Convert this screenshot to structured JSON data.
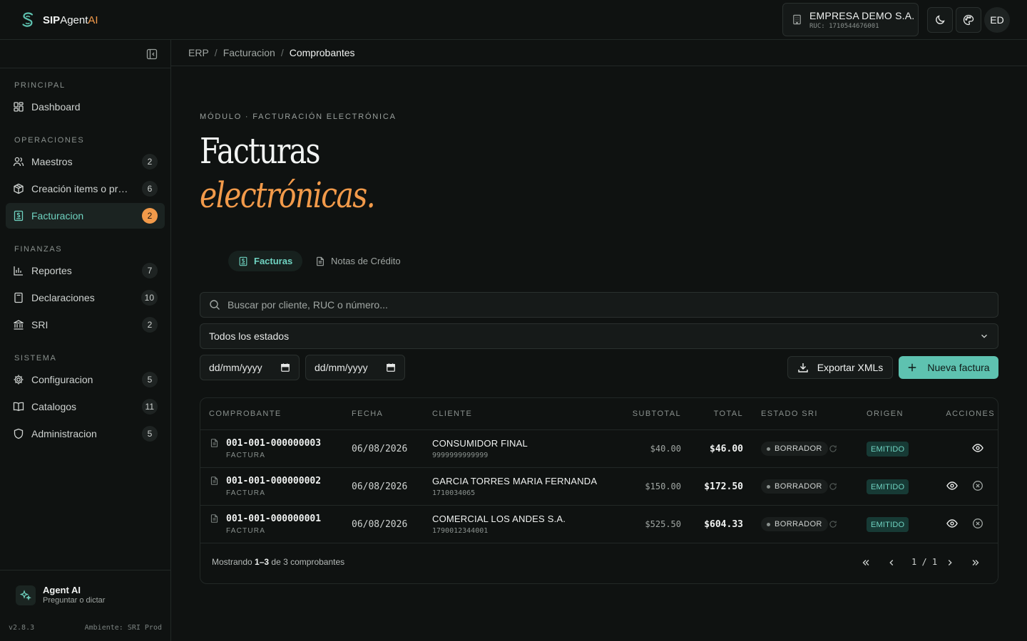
{
  "brand": {
    "sip": "SIP",
    "agent": "Agent",
    "ai": "AI"
  },
  "company": {
    "name": "EMPRESA DEMO S.A.",
    "ruc": "RUC: 1710544676001"
  },
  "user": {
    "initials": "ED"
  },
  "sidebar": {
    "sections": [
      {
        "title": "PRINCIPAL"
      },
      {
        "title": "OPERACIONES"
      },
      {
        "title": "FINANZAS"
      },
      {
        "title": "SISTEMA"
      }
    ],
    "items": [
      {
        "label": "Dashboard",
        "badge": "",
        "icon": "dashboard-icon"
      },
      {
        "label": "Maestros",
        "badge": "2",
        "icon": "users-icon"
      },
      {
        "label": "Creación items o pro...",
        "badge": "6",
        "icon": "box-icon"
      },
      {
        "label": "Facturacion",
        "badge": "2",
        "icon": "invoice-icon",
        "active": true
      },
      {
        "label": "Reportes",
        "badge": "7",
        "icon": "bar-chart-icon"
      },
      {
        "label": "Declaraciones",
        "badge": "10",
        "icon": "calculator-icon"
      },
      {
        "label": "SRI",
        "badge": "2",
        "icon": "bank-icon"
      },
      {
        "label": "Configuracion",
        "badge": "5",
        "icon": "gear-icon"
      },
      {
        "label": "Catalogos",
        "badge": "11",
        "icon": "book-icon"
      },
      {
        "label": "Administracion",
        "badge": "5",
        "icon": "shield-icon"
      }
    ],
    "agent": {
      "title": "Agent AI",
      "subtitle": "Preguntar o dictar"
    },
    "version": "v2.8.3",
    "environment": "Ambiente: SRI Prod"
  },
  "breadcrumb": [
    "ERP",
    "Facturacion",
    "Comprobantes"
  ],
  "header": {
    "eyebrow": "MÓDULO · FACTURACIÓN ELECTRÓNICA",
    "title_line1": "Facturas",
    "title_line2": "electrónicas."
  },
  "tabs": [
    {
      "label": "Facturas",
      "active": true
    },
    {
      "label": "Notas de Crédito",
      "active": false
    }
  ],
  "filters": {
    "search_placeholder": "Buscar por cliente, RUC o número...",
    "status_selected": "Todos los estados",
    "date_from_placeholder": "dd/mm/yyyy",
    "date_to_placeholder": "dd/mm/yyyy"
  },
  "actions": {
    "export_label": "Exportar XMLs",
    "new_label": "Nueva factura"
  },
  "table": {
    "columns": [
      "COMPROBANTE",
      "FECHA",
      "CLIENTE",
      "SUBTOTAL",
      "TOTAL",
      "ESTADO SRI",
      "ORIGEN",
      "ACCIONES"
    ],
    "rows": [
      {
        "number": "001-001-000000003",
        "type": "FACTURA",
        "date": "06/08/2026",
        "client": "CONSUMIDOR FINAL",
        "ruc": "9999999999999",
        "subtotal": "$40.00",
        "total": "$46.00",
        "status": "BORRADOR",
        "origin": "EMITIDO",
        "cancellable": false
      },
      {
        "number": "001-001-000000002",
        "type": "FACTURA",
        "date": "06/08/2026",
        "client": "GARCIA TORRES MARIA FERNANDA",
        "ruc": "1710034065",
        "subtotal": "$150.00",
        "total": "$172.50",
        "status": "BORRADOR",
        "origin": "EMITIDO",
        "cancellable": true
      },
      {
        "number": "001-001-000000001",
        "type": "FACTURA",
        "date": "06/08/2026",
        "client": "COMERCIAL LOS ANDES S.A.",
        "ruc": "1790012344001",
        "subtotal": "$525.50",
        "total": "$604.33",
        "status": "BORRADOR",
        "origin": "EMITIDO",
        "cancellable": true
      }
    ],
    "footer": {
      "prefix": "Mostrando",
      "range": "1–3",
      "suffix": "de 3 comprobantes",
      "page": "1 / 1"
    }
  },
  "colors": {
    "accent": "#5ec2b0",
    "brand_orange": "#f29a4a",
    "background": "#0f1211"
  }
}
